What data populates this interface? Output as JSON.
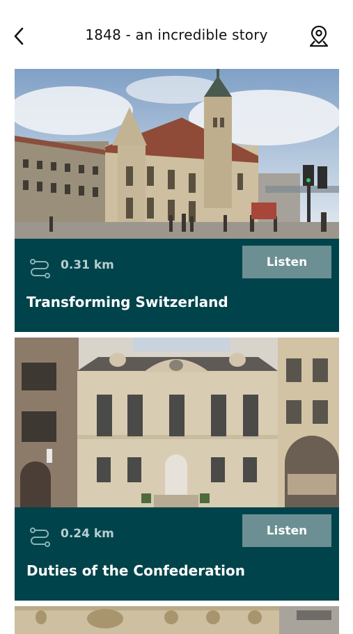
{
  "header": {
    "title": "1848 - an incredible story",
    "back_icon": "chevron-left-icon",
    "map_icon": "map-pin-icon"
  },
  "stops": [
    {
      "distance": "0.31 km",
      "listen_label": "Listen",
      "title": "Transforming Switzerland"
    },
    {
      "distance": "0.24 km",
      "listen_label": "Listen",
      "title": "Duties of the Confederation"
    }
  ],
  "colors": {
    "card_background": "#00434a",
    "listen_button": "#6b8f93",
    "distance_text": "#b8cfd2"
  }
}
